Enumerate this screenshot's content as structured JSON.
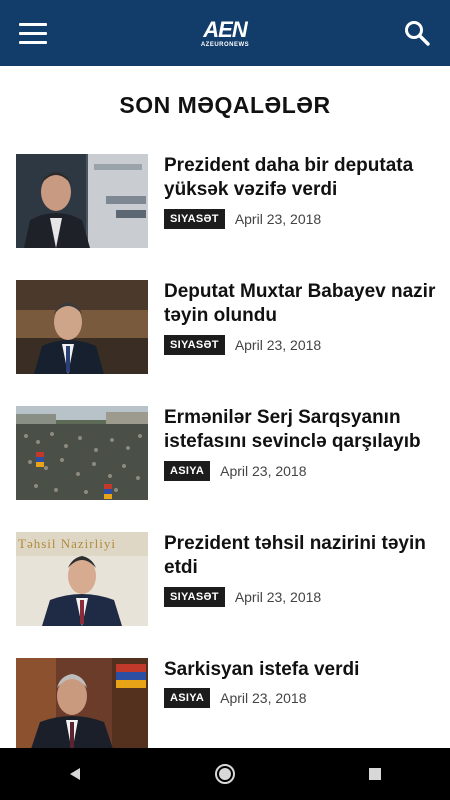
{
  "header": {
    "logo_mark": "AEN",
    "logo_sub": "AZEURONEWS"
  },
  "section": {
    "title": "SON MƏQALƏLƏR"
  },
  "articles": [
    {
      "headline": "Prezident daha bir deputata yüksək vəzifə verdi",
      "category": "SIYASƏT",
      "date": "April 23, 2018"
    },
    {
      "headline": "Deputat Muxtar Babayev nazir təyin olundu",
      "category": "SIYASƏT",
      "date": "April 23, 2018"
    },
    {
      "headline": "Ermənilər Serj Sarqsyanın istefasını sevinclə qarşılayıb",
      "category": "ASIYA",
      "date": "April 23, 2018"
    },
    {
      "headline": "Prezident təhsil nazirini təyin etdi",
      "category": "SIYASƏT",
      "date": "April 23, 2018",
      "image_text": "Təhsil Nazirliyi"
    },
    {
      "headline": "Sarkisyan istefa verdi",
      "category": "ASIYA",
      "date": "April 23, 2018"
    }
  ],
  "colors": {
    "header_bg": "#123c69",
    "badge_bg": "#1c1c1c",
    "navbar_bg": "#000000"
  },
  "icons": {
    "menu": "hamburger-menu-icon",
    "search": "search-icon",
    "back": "back-triangle-icon",
    "home": "home-circle-icon",
    "recents": "recents-square-icon"
  }
}
